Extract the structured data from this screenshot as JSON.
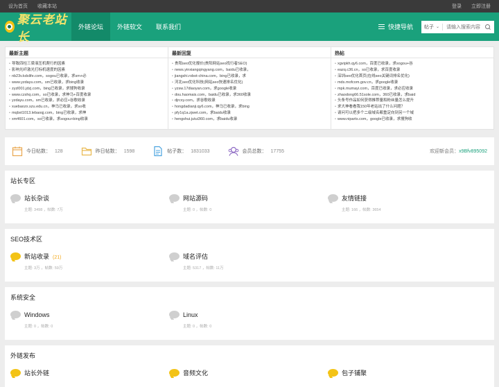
{
  "topbar": {
    "left": [
      "设为首页",
      "收藏本站"
    ],
    "right": [
      "登录",
      "立即注册"
    ]
  },
  "nav": {
    "logo_text": "聚云老站长",
    "links": [
      "外链论坛",
      "外链软文",
      "联系我们"
    ],
    "quick_nav": "快捷导航",
    "search_select": "帖子",
    "search_placeholder": "请输入搜索内容"
  },
  "news": {
    "columns": [
      {
        "title": "最新主题",
        "items": [
          "导致四柱三梁液压机爬行的因素",
          "影响光纤激光打标机速度的因素",
          "nb23v.kdslife.com，sogou已收录，求sm+必",
          "www.yzdayu.com，sm已收录，求bing收录",
          "zyzl001.jdzj.com，bing已收录，求搜狗收录",
          "www.czshq.com，so已收录，求神马+百度收录",
          "yzdayu.com，sm已收录，求必应+谷歌收录",
          "xuebaozx.szu.edu.cn，神马已收录，求so收",
          "mqbxt1013.lebaoqj.com，bing已收录，求神",
          "xm4601.com，so已收录，求sogou+bing收录"
        ]
      },
      {
        "title": "最新回复",
        "items": [
          "贵阳seo优化报价(贵阳网站seo找行者SEO)",
          "news.yinxiangqingyang.com，baidu已收录，",
          "jiangshi.robot-china.com，bing已收录，求",
          "河北seo优化科技(网站seo快速排名优化)",
          "yzsw.17diaoyan.com，求google收录",
          "dou.haomais.com，baidu已收录，求360收录",
          "djrcxy.com，求谷歌收录",
          "hongdadianji.qy6.com，神马已收录，求bing",
          "pfy1q1a.zjwet.com，求baidu收录",
          "hengshui.jutui360.com，求baidu收录"
        ]
      },
      {
        "title": "热帖",
        "items": [
          "xgvipkh.qy6.com，百度已收录，求sogou+谷",
          "eazq.c36.cn，so已收录，求百度收录",
          "深圳seo优化首页(在线seo关键词排名优化)",
          "mds.mofcom.gov.cn，求google收录",
          "mpk.mumayi.com，百度已收录，求必应收录",
          "zhaodong66.51sole.com，360已收录，求baid",
          "头条号作品如何获得推荐量和粉丝量怎么提升",
          "求大神看看我150年老站出了什么问题？",
          "请问可以把多个二级域名都重定向到另一个域",
          "www.niparts.com，google已收录，求搜狗收"
        ]
      }
    ]
  },
  "stats": {
    "today": {
      "label": "今日帖数：",
      "value": "128"
    },
    "yesterday": {
      "label": "昨日帖数：",
      "value": "1598"
    },
    "posts": {
      "label": "帖子数：",
      "value": "1831033"
    },
    "members": {
      "label": "会员总数：",
      "value": "17755"
    },
    "welcome_label": "欢迎新会员：",
    "welcome_user": "x9Bfv895092"
  },
  "sections": [
    {
      "title": "站长专区",
      "forums": [
        {
          "name": "站长杂谈",
          "meta": "主题: 3498 ，帖数: 7万",
          "today": "",
          "icon_color": "gray"
        },
        {
          "name": "网站源码",
          "meta": "主题: 0 ，帖数: 0",
          "today": "",
          "icon_color": "gray"
        },
        {
          "name": "友情链接",
          "meta": "主题: 166 ，帖数: 3654",
          "today": "",
          "icon_color": "gray"
        }
      ]
    },
    {
      "title": "SEO技术区",
      "forums": [
        {
          "name": "新站收录",
          "meta": "主题: 3万 ，帖数: 59万",
          "today": "(21)",
          "icon_color": "yellow"
        },
        {
          "name": "域名评估",
          "meta": "主题: 5317 ，帖数: 11万",
          "today": "",
          "icon_color": "gray"
        }
      ]
    },
    {
      "title": "系统安全",
      "forums": [
        {
          "name": "Windows",
          "meta": "主题: 0 ，帖数: 0",
          "today": "",
          "icon_color": "gray"
        },
        {
          "name": "Linux",
          "meta": "主题: 0 ，帖数: 0",
          "today": "",
          "icon_color": "gray"
        }
      ]
    },
    {
      "title": "外链发布",
      "forums": [
        {
          "name": "站长外链",
          "meta": "",
          "today": "",
          "icon_color": "yellow"
        },
        {
          "name": "音频文化",
          "meta": "",
          "today": "",
          "icon_color": "yellow"
        },
        {
          "name": "包子铺聚",
          "meta": "",
          "today": "",
          "icon_color": "yellow"
        }
      ]
    }
  ]
}
